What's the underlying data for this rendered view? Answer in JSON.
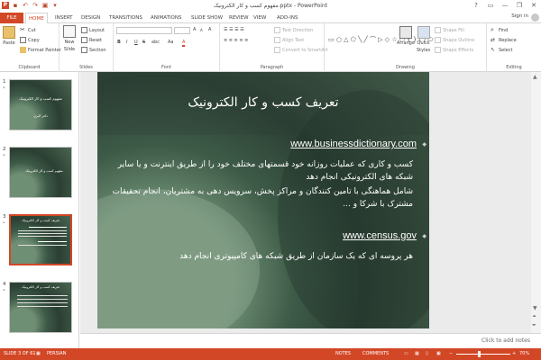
{
  "window": {
    "title": "مفهوم کسب و کار الکترونیک.pptx - PowerPoint",
    "help": "?",
    "minimize": "—",
    "restore": "❐",
    "close": "✕"
  },
  "qat": {
    "save": "▪",
    "undo": "↶",
    "redo": "↷",
    "start": "▣",
    "more": "▾"
  },
  "tabs": [
    "FILE",
    "HOME",
    "INSERT",
    "DESIGN",
    "TRANSITIONS",
    "ANIMATIONS",
    "SLIDE SHOW",
    "REVIEW",
    "VIEW",
    "ADD-INS"
  ],
  "account": {
    "sign_in": "Sign in"
  },
  "ribbon": {
    "clipboard": {
      "paste": "Paste",
      "cut": "Cut",
      "copy": "Copy",
      "format_painter": "Format Painter",
      "label": "Clipboard"
    },
    "slides": {
      "new_slide": "New",
      "new_slide2": "Slide",
      "layout": "Layout",
      "reset": "Reset",
      "section": "Section",
      "label": "Slides"
    },
    "font": {
      "label": "Font",
      "bold": "B",
      "italic": "I",
      "underline": "U",
      "strike": "S",
      "abc": "abc",
      "aa": "Aa",
      "grow": "A",
      "shrink": "A",
      "clear": "A",
      "color": "A"
    },
    "paragraph": {
      "text_direction": "Text Direction",
      "align_text": "Align Text",
      "smartart": "Convert to SmartArt",
      "label": "Paragraph"
    },
    "drawing": {
      "arrange": "Arrange",
      "quick_styles": "Quick",
      "quick_styles2": "Styles",
      "shape_fill": "Shape Fill",
      "shape_outline": "Shape Outline",
      "shape_effects": "Shape Effects",
      "label": "Drawing"
    },
    "editing": {
      "find": "Find",
      "replace": "Replace",
      "select": "Select",
      "label": "Editing"
    }
  },
  "thumbnails": [
    {
      "num": "1",
      "star": "*",
      "title": "مفهوم کسب و کار الکترونیک",
      "sub": "دکتر اکبری"
    },
    {
      "num": "2",
      "star": "*",
      "title": "مفهوم کسب و کار الکترونیک",
      "sub": ""
    },
    {
      "num": "3",
      "star": "*",
      "title": "تعریف کسب و کار الکترونیک",
      "sub": ""
    },
    {
      "num": "4",
      "star": "*",
      "title": "تعریف کسب و کار الکترونیک",
      "sub": ""
    },
    {
      "num": "5",
      "star": "",
      "title": "",
      "sub": ""
    }
  ],
  "slide": {
    "title": "تعریف کسب و کار الکترونیک",
    "link1": "www.businessdictionary.com",
    "bullets1": [
      "کسب و کاری که عملیات روزانه خود قسمتهای مختلف خود را از طریق اینترنت و یا سایر شبکه های الکترونیکی انجام دهد",
      "شامل هماهنگی با تامین کنندگان و مراکز پخش، سرویس دهی به مشتریان، انجام تحقیقات مشترک با شرکا و ..."
    ],
    "link2": "www.census.gov",
    "bullets2": [
      "هر پروسه ای که یک سازمان از طریق شبکه های کامپیوتری انجام دهد"
    ],
    "bullet_char": "◆"
  },
  "notes": {
    "placeholder": "Click to add notes"
  },
  "status": {
    "slide": "SLIDE 3 OF 61",
    "language": "PERSIAN",
    "notes": "NOTES",
    "comments": "COMMENTS",
    "zoom": "70%",
    "minus": "−",
    "plus": "+"
  },
  "colors": {
    "accent": "#d24726",
    "link": "#ffffff",
    "slide_text": "#ffffff"
  }
}
